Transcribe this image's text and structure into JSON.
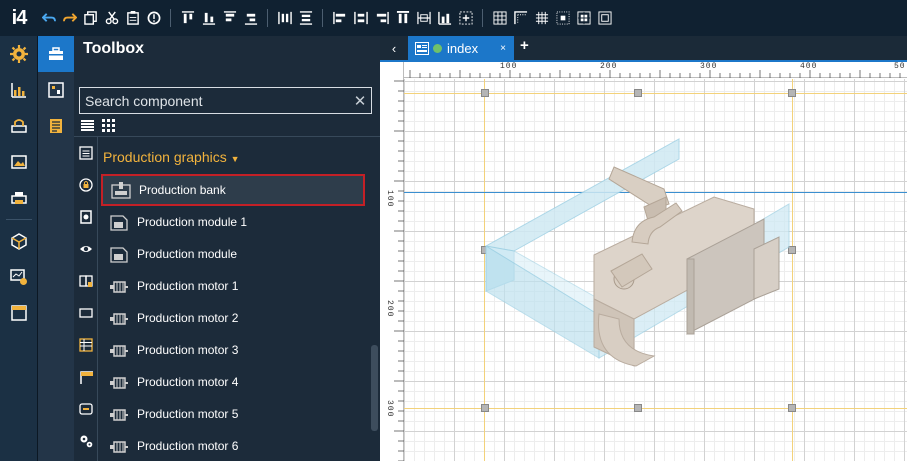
{
  "app": {
    "logo": "i4"
  },
  "toolbar": {
    "groups": [
      [
        "undo-icon",
        "redo-icon",
        "copy-icon",
        "cut-icon",
        "paste-icon",
        "info-icon"
      ],
      [
        "align-top-icon",
        "align-bottom-icon",
        "align-middle-top-icon",
        "align-middle-bottom-icon"
      ],
      [
        "distribute-vertical-icon",
        "distribute-horizontal-icon"
      ],
      [
        "align-left-icon",
        "align-center-icon",
        "align-right-icon",
        "align-top-edge-icon",
        "align-center-v-icon",
        "align-bottom-edge-icon",
        "center-selection-icon"
      ],
      [
        "grid-icon",
        "grid-corner-icon",
        "grid-lines-icon",
        "grid-dots-icon",
        "grid-snap-icon",
        "grid-frame-icon"
      ]
    ]
  },
  "left_nav": [
    "settings-icon",
    "chart-icon",
    "plc-icon",
    "image-icon",
    "printer-icon",
    "package-icon",
    "dashboard-gear-icon",
    "window-icon"
  ],
  "second_nav": [
    "toolbox-icon",
    "screen-icon",
    "document-icon"
  ],
  "toolbox": {
    "title": "Toolbox",
    "search": {
      "placeholder": "Search component",
      "value": ""
    },
    "category": "Production graphics",
    "categories": [
      "list-icon",
      "lock-icon",
      "device-icon",
      "eye-icon",
      "book-icon",
      "rect-icon",
      "table-icon",
      "window-icon",
      "code-icon",
      "gears-icon"
    ],
    "items": [
      {
        "label": "Production bank",
        "icon": "production-bank-icon",
        "selected": true
      },
      {
        "label": "Production module 1",
        "icon": "module-icon",
        "selected": false
      },
      {
        "label": "Production module",
        "icon": "module-icon",
        "selected": false
      },
      {
        "label": "Production motor 1",
        "icon": "motor-icon",
        "selected": false
      },
      {
        "label": "Production motor 2",
        "icon": "motor-icon",
        "selected": false
      },
      {
        "label": "Production motor 3",
        "icon": "motor-icon",
        "selected": false
      },
      {
        "label": "Production motor 4",
        "icon": "motor-icon",
        "selected": false
      },
      {
        "label": "Production motor 5",
        "icon": "motor-icon",
        "selected": false
      },
      {
        "label": "Production motor 6",
        "icon": "motor-icon",
        "selected": false
      }
    ]
  },
  "editor": {
    "tab": {
      "label": "index",
      "close": "×"
    },
    "add_tab": "+",
    "back": "‹",
    "ruler_h": [
      "100",
      "200",
      "300",
      "400",
      "50"
    ],
    "ruler_v": [
      "100",
      "200",
      "300"
    ],
    "colors": {
      "accent": "#1c77c9",
      "selection_border": "#c42026",
      "category": "#f2b33d",
      "guide_yellow": "#f3d27a",
      "guide_blue": "#3a8fd0"
    }
  }
}
